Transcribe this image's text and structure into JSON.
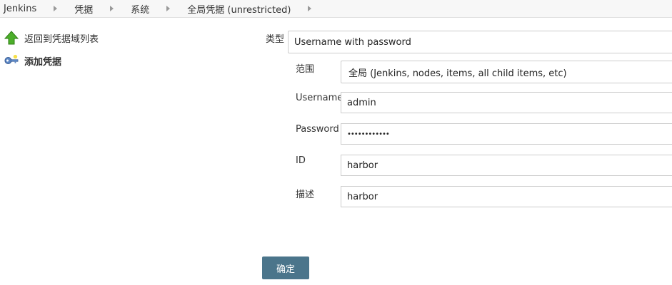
{
  "breadcrumb": [
    "Jenkins",
    "凭据",
    "系统",
    "全局凭据 (unrestricted)"
  ],
  "sidebar": {
    "items": [
      {
        "label": "返回到凭据域列表",
        "icon": "up-arrow-icon"
      },
      {
        "label": "添加凭据",
        "icon": "key-icon"
      }
    ]
  },
  "form": {
    "kind_label": "类型",
    "kind_value": "Username with password",
    "scope_label": "范围",
    "scope_value": "全局 (Jenkins, nodes, items, all child items, etc)",
    "username_label": "Username",
    "username_value": "admin",
    "password_label": "Password",
    "password_value": "••••••••••••",
    "id_label": "ID",
    "id_value": "harbor",
    "description_label": "描述",
    "description_value": "harbor",
    "submit_label": "确定"
  },
  "colors": {
    "button": "#4b758b",
    "arrow_green": "#4caf2a",
    "key_blue": "#5b86c4"
  }
}
